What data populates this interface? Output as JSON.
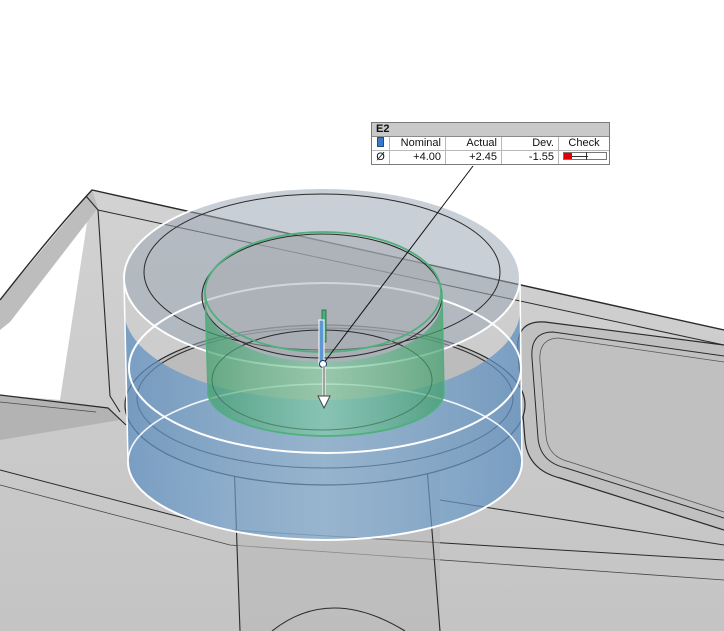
{
  "measurement_label": {
    "title": "E2",
    "headers": {
      "nominal": "Nominal",
      "actual": "Actual",
      "deviation": "Dev.",
      "check": "Check"
    },
    "row": {
      "symbol": "Ø",
      "nominal": "+4.00",
      "actual": "+2.45",
      "deviation": "-1.55"
    },
    "check_fraction": 0.18,
    "colors": {
      "nominal_icon": "#3a78c9",
      "check_fail": "#e00000"
    }
  },
  "colors": {
    "nominal_cylinder": "#6d9fcf",
    "actual_cylinder": "#5fbd8a",
    "part_surface": "#c8c8c8",
    "background": "#ffffff"
  },
  "icons": {
    "nominal_marker": "blue-bar-icon",
    "direction_arrow": "arrow-down-icon"
  }
}
